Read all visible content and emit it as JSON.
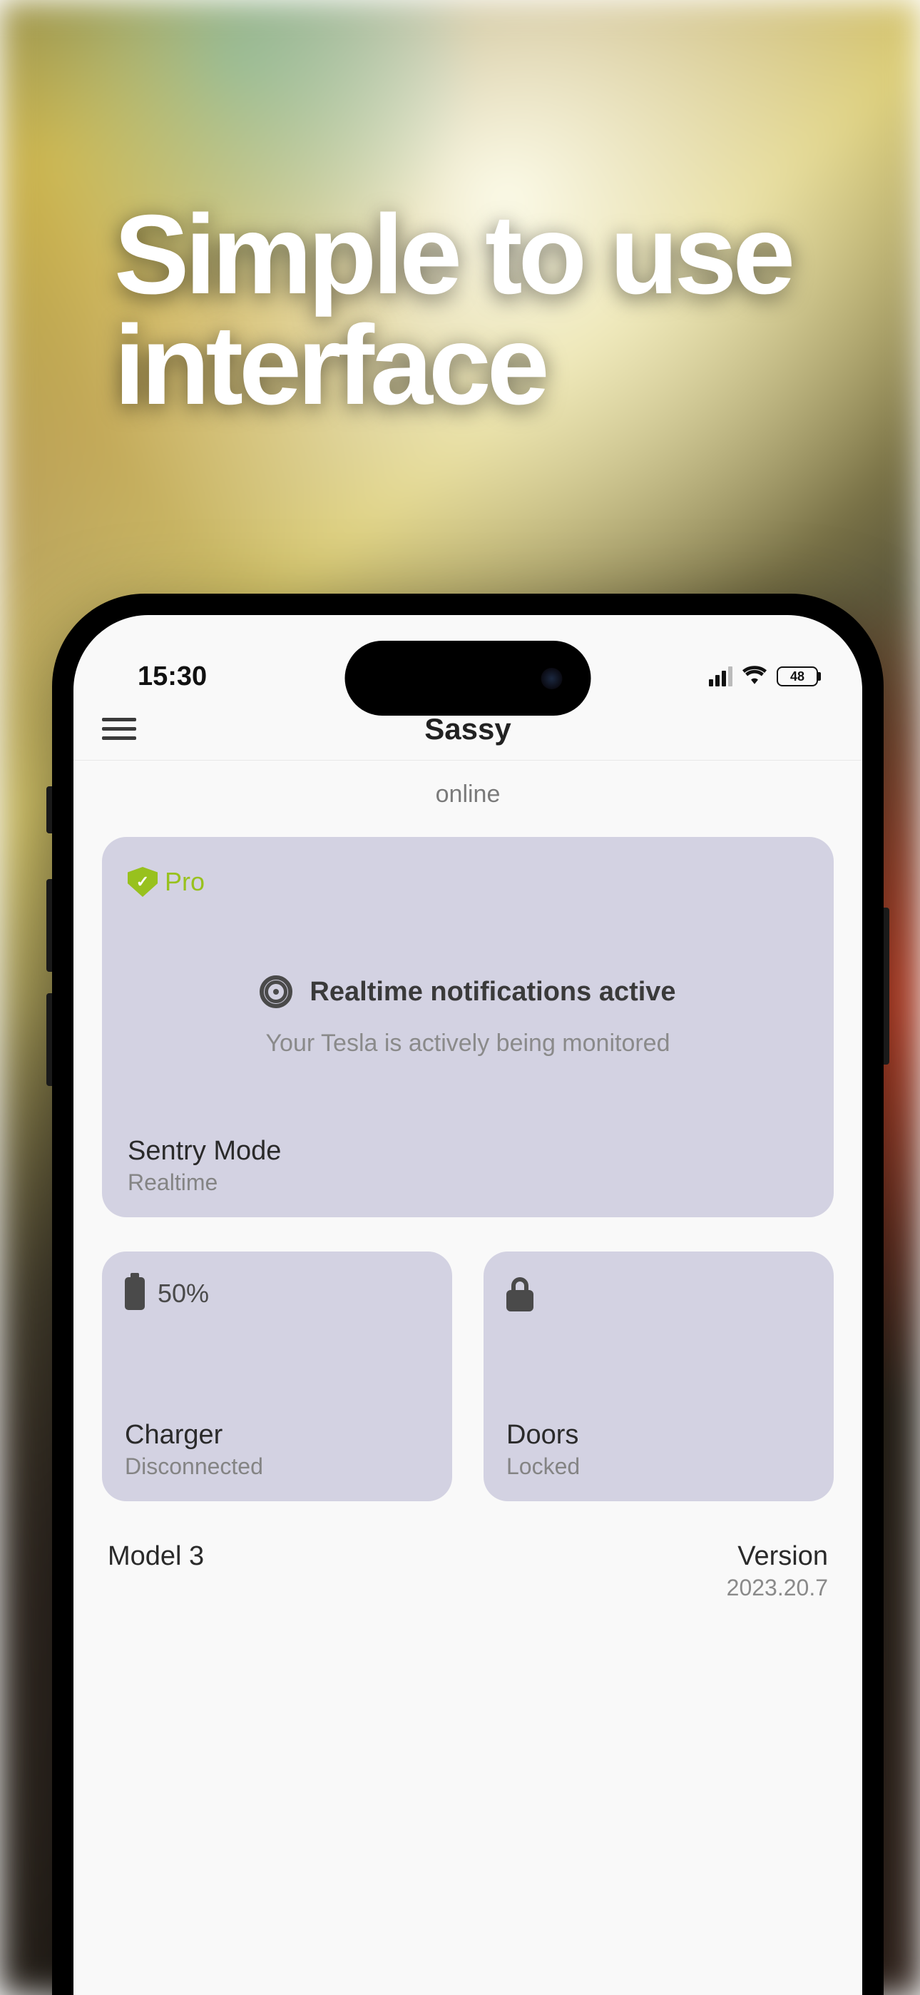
{
  "marketing": {
    "headline_l1": "Simple to use",
    "headline_l2": "interface"
  },
  "status_bar": {
    "time": "15:30",
    "battery_percent": "48"
  },
  "header": {
    "title": "Sassy"
  },
  "status_text": "online",
  "sentry_card": {
    "pro_label": "Pro",
    "title": "Realtime notifications active",
    "subtitle": "Your Tesla is actively being monitored",
    "label": "Sentry Mode",
    "sublabel": "Realtime"
  },
  "charger_card": {
    "percent": "50%",
    "label": "Charger",
    "sublabel": "Disconnected"
  },
  "doors_card": {
    "label": "Doors",
    "sublabel": "Locked"
  },
  "footer": {
    "model": "Model 3",
    "version_label": "Version",
    "version_value": "2023.20.7"
  }
}
